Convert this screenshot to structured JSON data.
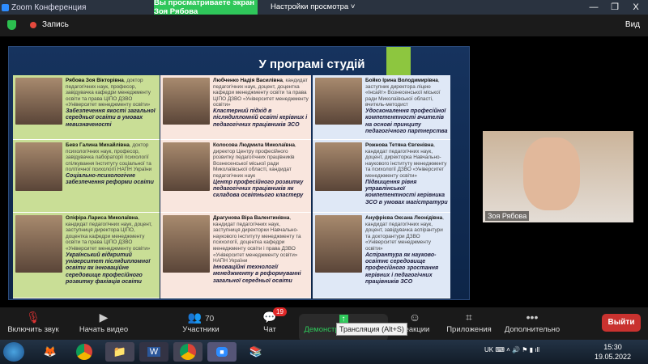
{
  "window": {
    "title": "Zoom Конференция",
    "banner": "Вы просматриваете экран Зоя Рябова",
    "view_settings": "Настройки просмотра ˅",
    "minimize": "—",
    "restore": "❐",
    "close": "X"
  },
  "topbar": {
    "record": "Запись",
    "view": "Вид"
  },
  "slide": {
    "title": "У програмі студій",
    "columns": [
      {
        "color": "#c9de96",
        "cells": [
          {
            "name": "Рябова Зоя Вікторівна",
            "bio": ", доктор педагогічних наук, професор, завідувачка кафедри менеджменту освіти та права ЦІПО ДЗВО «Університет менеджменту освіти»",
            "topic": "Забезпечення якості загальної середньої освіти в умовах невизначеності"
          },
          {
            "name": "Бевз Галина Михайлівна",
            "bio": ", доктор психологічних наук, професор, завідувачка лабораторії психології спілкування Інституту соціальної та політичної психології НАПН України",
            "topic": "Соціально-психологічне забезпечення реформи освіти"
          },
          {
            "name": "Оліфіра Лариса Миколаївна",
            "bio": ", кандидат педагогічних наук, доцент, заступниця директора ЦІПО, доцентка кафедри менеджменту освіти та права ЦІПО ДЗВО «Університет менеджменту освіти»",
            "topic": "Український відкритий університет післядипломної освіти як інноваційне середовище професійного розвитку фахівців освіти"
          }
        ]
      },
      {
        "color": "#f9e6de",
        "cells": [
          {
            "name": "Любченко Надія Василівна",
            "bio": ", кандидат педагогічних наук, доцент, доцентка кафедри менеджменту освіти та права ЦІПО ДЗВО «Університет менеджменту освіти»",
            "topic": "Кластерний підхід в післядипломній освіті керівних і педагогічних працівників ЗСО"
          },
          {
            "name": "Колосова Людмила Миколаївна",
            "bio": ", директор Центру професійного розвитку педагогічних працівників Вознесенської міської ради Миколаївської області, кандидат педагогічних наук",
            "topic": "Центр професійного розвитку педагогічних працівників як складова освітнього кластеру"
          },
          {
            "name": "Драгунова Віра Валентинівна",
            "bio": ", кандидат педагогічних наук, заступниця директорки Навчально-наукового інституту менеджменту та психології, доцентка кафедри менеджменту освіти і права ДЗВО «Університет менеджменту освіти» НАПН України",
            "topic": "Інноваційні технології менеджменту в реформуванні загальної середньої освіти"
          }
        ]
      },
      {
        "color": "#dfe8f6",
        "cells": [
          {
            "name": "Бойко Ірина Володимирівна",
            "bio": ", заступник директора ліцею «Інсайт» Вознесенської міської ради Миколаївської області, вчитель-методист",
            "topic": "Удосконалення професійної компетентності вчителів на основі принципу педагогічного партнерства"
          },
          {
            "name": "Рожнова Тетяна Євгенівна",
            "bio": ", кандидат педагогічних наук, доцент, директорка Навчально-наукового інституту менеджменту та психології ДЗВО «Університет менеджменту освіти»",
            "topic": "Підвищення рівня управлінської компетентності керівника ЗСО в умовах магістратури"
          },
          {
            "name": "Ануфрієва Оксана Леонідівна",
            "bio": ", кандидат педагогічних наук, доцент, завідувачка аспірантури та докторантури ДЗВО «Університет менеджменту освіти»",
            "topic": "Аспірантура як науково-освітнє середовище професійного зростання керівних і педагогічних працівників ЗСО"
          }
        ]
      }
    ]
  },
  "video": {
    "name": "Зоя Рябова"
  },
  "toolbar": {
    "audio": "Включить звук",
    "video": "Начать видео",
    "participants": "Участники",
    "participants_count": "70",
    "chat": "Чат",
    "chat_badge": "19",
    "share": "Демонстрация экрана",
    "reactions": "Реакции",
    "apps": "Приложения",
    "more": "Дополнительно",
    "leave": "Выйти",
    "tooltip": "Трансляция (Alt+S)"
  },
  "taskbar": {
    "lang": "UK",
    "time": "15:30",
    "date": "19.05.2022"
  }
}
